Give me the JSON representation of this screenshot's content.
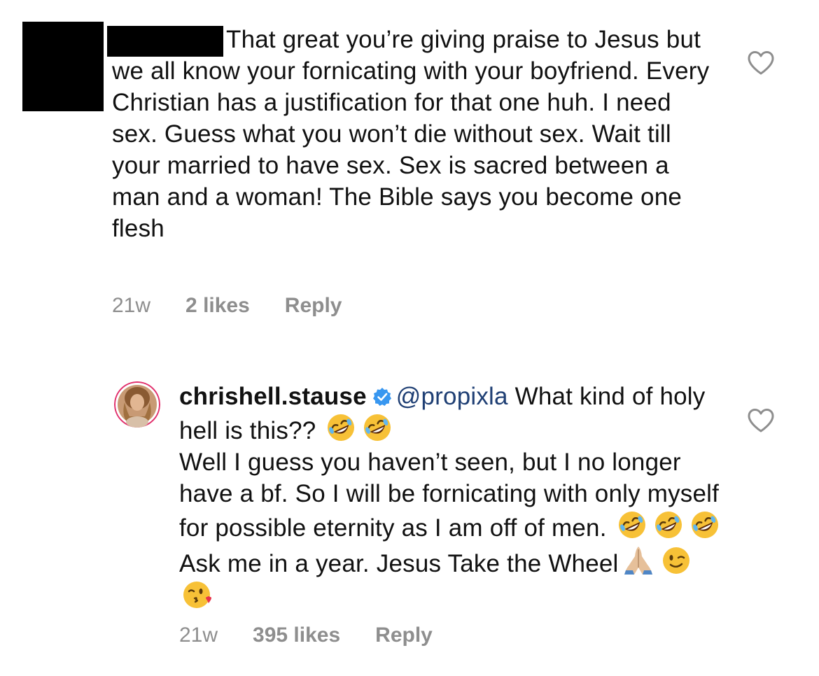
{
  "comments": [
    {
      "username_redacted": true,
      "text": "That great you’re giving praise to Jesus but we all know your fornicating with your boyfriend. Every Christian has a justification for that one huh. I need sex. Guess what you won’t die without sex. Wait till your married to have sex. Sex is sacred between a man and a woman! The Bible says you become one flesh",
      "time": "21w",
      "likes": "2 likes",
      "reply_label": "Reply",
      "like_icon": "heart-outline-icon"
    },
    {
      "username": "chrishell.stause",
      "verified": true,
      "mention": "@propixla",
      "text_part1": " What kind of holy hell is this??",
      "text_part2": "Well I guess you haven’t seen, but I no longer have a bf. So I will be fornicating with only myself for possible eternity as I am off of men.",
      "text_part3": "Ask me in a year. Jesus Take the Wheel",
      "emojis": [
        "rolling-on-floor-laughing",
        "winking-face",
        "face-blowing-kiss",
        "folded-hands"
      ],
      "time": "21w",
      "likes": "395 likes",
      "reply_label": "Reply",
      "like_icon": "heart-outline-icon",
      "colors": {
        "mention": "#1f3f74",
        "verified_badge": "#3897f0",
        "avatar_ring": "#e1306c"
      }
    }
  ],
  "colors": {
    "meta_text": "#8e8e8e",
    "body_text": "#111111",
    "redaction": "#000000"
  }
}
